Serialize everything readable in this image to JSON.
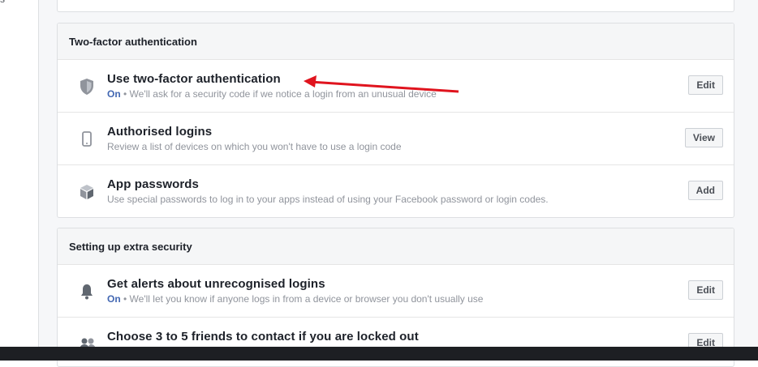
{
  "gutter": {
    "cut_text": "s"
  },
  "sections": [
    {
      "title": "Two-factor authentication",
      "rows": [
        {
          "title": "Use two-factor authentication",
          "status": "On",
          "desc": "We'll ask for a security code if we notice a login from an unusual device",
          "button": "Edit",
          "icon": "shield-icon"
        },
        {
          "title": "Authorised logins",
          "desc": "Review a list of devices on which you won't have to use a login code",
          "button": "View",
          "icon": "phone-icon"
        },
        {
          "title": "App passwords",
          "desc": "Use special passwords to log in to your apps instead of using your Facebook password or login codes.",
          "button": "Add",
          "icon": "cube-icon"
        }
      ]
    },
    {
      "title": "Setting up extra security",
      "rows": [
        {
          "title": "Get alerts about unrecognised logins",
          "status": "On",
          "desc": "We'll let you know if anyone logs in from a device or browser you don't usually use",
          "button": "Edit",
          "icon": "bell-icon"
        },
        {
          "title": "Choose 3 to 5 friends to contact if you are locked out",
          "desc": "",
          "button": "Edit",
          "icon": "friends-icon"
        }
      ]
    }
  ],
  "colors": {
    "status_on": "#4267b2",
    "arrow": "#e0141e",
    "taskbar": "#1d1f23"
  }
}
